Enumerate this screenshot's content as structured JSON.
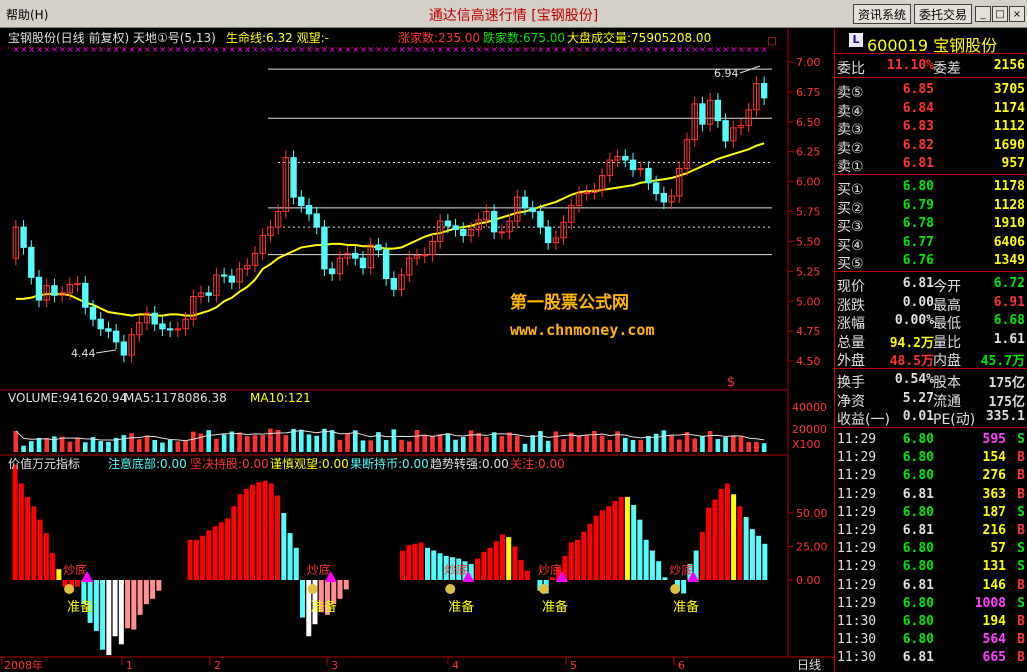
{
  "menu": {
    "help": "帮助(H)"
  },
  "app": {
    "title": "通达信高速行情 [宝钢股份]"
  },
  "toolbar": {
    "news_label": "资讯系统",
    "trade_label": "委托交易"
  },
  "window": {
    "min": "_",
    "max": "□",
    "close": "×"
  },
  "colors": {
    "up": "#ff3232",
    "down": "#54fcfc",
    "ma": "#ffff00",
    "ma_alt": "#00c800",
    "white_bar": "#ffffff",
    "pink_bar": "#ff9090",
    "yellow_bar": "#ffff00",
    "magenta": "#ff00ff",
    "grid": "#b40000",
    "price_label": "#ff3232"
  },
  "chart_data": [
    {
      "type": "candlestick",
      "name": "main",
      "header": {
        "title": "宝钢股份(日线 前复权) 天地①号(5,13)",
        "indicator": "生命线:6.32 观望:-",
        "up_count": "涨家数:235.00",
        "down_count": "跌家数:675.00",
        "market_vol": "大盘成交量:75905208.00"
      },
      "ylim": [
        4.3,
        7.1
      ],
      "yticks": [
        "7.00",
        "6.75",
        "6.50",
        "6.25",
        "6.00",
        "5.75",
        "5.50",
        "5.25",
        "5.00",
        "4.75",
        "4.50"
      ],
      "ytick_values": [
        7.0,
        6.75,
        6.5,
        6.25,
        6.0,
        5.75,
        5.5,
        5.25,
        5.0,
        4.75,
        4.5
      ],
      "annotations": {
        "high": "6.94",
        "low": "4.44",
        "watermark_line1": "第一股票公式网",
        "watermark_line2": "www.chnmoney.com",
        "dollar": "$"
      },
      "candles": [
        [
          5.36,
          5.62
        ],
        [
          5.62,
          5.45
        ],
        [
          5.45,
          5.2
        ],
        [
          5.2,
          5.01
        ],
        [
          5.01,
          5.13
        ],
        [
          5.13,
          5.05
        ],
        [
          5.05,
          5.07
        ],
        [
          5.07,
          5.14
        ],
        [
          5.14,
          5.15
        ],
        [
          5.15,
          4.95
        ],
        [
          4.95,
          4.85
        ],
        [
          4.85,
          4.77
        ],
        [
          4.77,
          4.75
        ],
        [
          4.75,
          4.66
        ],
        [
          4.66,
          4.55
        ],
        [
          4.55,
          4.72
        ],
        [
          4.72,
          4.82
        ],
        [
          4.82,
          4.9
        ],
        [
          4.9,
          4.81
        ],
        [
          4.81,
          4.77
        ],
        [
          4.77,
          4.76
        ],
        [
          4.76,
          4.77
        ],
        [
          4.77,
          4.85
        ],
        [
          4.85,
          5.04
        ],
        [
          5.04,
          5.07
        ],
        [
          5.07,
          5.05
        ],
        [
          5.05,
          5.22
        ],
        [
          5.22,
          5.21
        ],
        [
          5.21,
          5.16
        ],
        [
          5.16,
          5.27
        ],
        [
          5.27,
          5.3
        ],
        [
          5.3,
          5.4
        ],
        [
          5.4,
          5.55
        ],
        [
          5.55,
          5.62
        ],
        [
          5.62,
          5.75
        ],
        [
          5.75,
          6.2
        ],
        [
          6.2,
          5.87
        ],
        [
          5.87,
          5.8
        ],
        [
          5.8,
          5.73
        ],
        [
          5.73,
          5.62
        ],
        [
          5.62,
          5.27
        ],
        [
          5.27,
          5.23
        ],
        [
          5.23,
          5.36
        ],
        [
          5.36,
          5.4
        ],
        [
          5.4,
          5.36
        ],
        [
          5.36,
          5.28
        ],
        [
          5.28,
          5.47
        ],
        [
          5.47,
          5.43
        ],
        [
          5.43,
          5.19
        ],
        [
          5.19,
          5.1
        ],
        [
          5.1,
          5.22
        ],
        [
          5.22,
          5.36
        ],
        [
          5.36,
          5.38
        ],
        [
          5.38,
          5.39
        ],
        [
          5.39,
          5.5
        ],
        [
          5.5,
          5.67
        ],
        [
          5.67,
          5.63
        ],
        [
          5.63,
          5.6
        ],
        [
          5.6,
          5.55
        ],
        [
          5.55,
          5.6
        ],
        [
          5.6,
          5.68
        ],
        [
          5.68,
          5.75
        ],
        [
          5.75,
          5.58
        ],
        [
          5.58,
          5.58
        ],
        [
          5.58,
          5.67
        ],
        [
          5.67,
          5.87
        ],
        [
          5.87,
          5.78
        ],
        [
          5.78,
          5.75
        ],
        [
          5.75,
          5.62
        ],
        [
          5.62,
          5.49
        ],
        [
          5.49,
          5.53
        ],
        [
          5.53,
          5.66
        ],
        [
          5.66,
          5.8
        ],
        [
          5.8,
          5.9
        ],
        [
          5.9,
          5.91
        ],
        [
          5.91,
          5.93
        ],
        [
          5.93,
          6.05
        ],
        [
          6.05,
          6.18
        ],
        [
          6.18,
          6.21
        ],
        [
          6.21,
          6.18
        ],
        [
          6.18,
          6.1
        ],
        [
          6.1,
          6.11
        ],
        [
          6.11,
          5.99
        ],
        [
          5.99,
          5.9
        ],
        [
          5.9,
          5.83
        ],
        [
          5.83,
          5.88
        ],
        [
          5.88,
          6.11
        ],
        [
          6.11,
          6.35
        ],
        [
          6.35,
          6.65
        ],
        [
          6.65,
          6.48
        ],
        [
          6.48,
          6.68
        ],
        [
          6.68,
          6.51
        ],
        [
          6.51,
          6.34
        ],
        [
          6.34,
          6.45
        ],
        [
          6.45,
          6.47
        ],
        [
          6.47,
          6.6
        ],
        [
          6.6,
          6.82
        ],
        [
          6.82,
          6.7
        ]
      ],
      "ma": [
        5.02,
        5.02,
        5.03,
        5.05,
        5.06,
        5.06,
        5.06,
        5.05,
        5.02,
        4.99,
        4.97,
        4.94,
        4.91,
        4.9,
        4.89,
        4.88,
        4.89,
        4.89,
        4.88,
        4.88,
        4.89,
        4.89,
        4.88,
        4.88,
        4.9,
        4.92,
        4.95,
        5.0,
        5.03,
        5.08,
        5.12,
        5.18,
        5.27,
        5.31,
        5.36,
        5.39,
        5.42,
        5.45,
        5.46,
        5.47,
        5.47,
        5.48,
        5.48,
        5.47,
        5.47,
        5.46,
        5.46,
        5.45,
        5.44,
        5.44,
        5.45,
        5.48,
        5.51,
        5.54,
        5.56,
        5.57,
        5.59,
        5.61,
        5.62,
        5.63,
        5.65,
        5.66,
        5.68,
        5.7,
        5.72,
        5.74,
        5.75,
        5.77,
        5.79,
        5.81,
        5.83,
        5.86,
        5.89,
        5.91,
        5.92,
        5.92,
        5.93,
        5.94,
        5.95,
        5.96,
        5.97,
        5.99,
        6.0,
        6.01,
        6.02,
        6.03,
        6.05,
        6.07,
        6.1,
        6.13,
        6.16,
        6.19,
        6.21,
        6.23,
        6.25,
        6.27,
        6.3,
        6.32
      ],
      "hlines_solid": [
        6.94,
        6.53,
        5.78,
        5.39
      ],
      "hlines_dashed": [
        6.16,
        5.62
      ]
    },
    {
      "type": "bar",
      "name": "volume",
      "header": {
        "vol": "VOLUME:941620.94",
        "ma5": "MA5:1178086.38",
        "ma10": "MA10:121"
      },
      "yticks": [
        "40000",
        "20000",
        "X100"
      ],
      "ytick_values": [
        40000,
        20000,
        0
      ],
      "values": [
        1.38,
        0.42,
        0.71,
        0.93,
        0.91,
        1.03,
        1.01,
        0.68,
        0.95,
        0.64,
        0.98,
        0.72,
        0.67,
        0.93,
        1.11,
        1.24,
        0.84,
        1.09,
        0.79,
        0.62,
        0.79,
        0.7,
        0.8,
        1.34,
        1.22,
        1.44,
        0.87,
        1.16,
        1.35,
        1.29,
        1.05,
        1.11,
        1.11,
        1.54,
        1.45,
        1.11,
        1.52,
        1.47,
        1.16,
        1.07,
        1.53,
        1.44,
        0.8,
        1.23,
        1.43,
        0.76,
        0.77,
        1.31,
        0.79,
        1.49,
        0.8,
        0.7,
        1.45,
        1.12,
        1.07,
        1.18,
        1.23,
        0.81,
        0.99,
        1.42,
        1.25,
        0.99,
        1.3,
        1.05,
        1.29,
        1.07,
        0.54,
        1.11,
        1.38,
        0.73,
        1.35,
        0.85,
        1.28,
        1.06,
        1.11,
        1.38,
        1.08,
        0.79,
        1.37,
        0.93,
        0.79,
        0.79,
        1.05,
        1.2,
        1.43,
        1.11,
        0.82,
        1.32,
        0.89,
        1.02,
        1.38,
        0.85,
        0.98,
        1.07,
        1.01,
        0.66,
        0.66,
        0.58
      ],
      "ylim": [
        0,
        2.9
      ]
    },
    {
      "type": "bar",
      "name": "value_indicator",
      "header": {
        "title": "价值万元指标",
        "c1": "注意底部:0.00",
        "c2": "坚决持股:0.00",
        "c3": "谨慎观望:0.00",
        "c4": "果断持币:0.00",
        "c5": "趋势转强:0.00",
        "c6": "关注:0.00"
      },
      "ylim": [
        -20,
        90
      ],
      "yticks": [
        "50.00",
        "25.00",
        "0.00"
      ],
      "ytick_values": [
        50,
        25,
        0
      ],
      "values": [
        86,
        72,
        62,
        55,
        45,
        35,
        20,
        8,
        -5,
        -9,
        -5,
        -18,
        -32,
        -38,
        -52,
        -56,
        -42,
        -48,
        -36,
        -37,
        -26,
        -18,
        -14,
        -8,
        0,
        5,
        8,
        8,
        30,
        30,
        33,
        37,
        40,
        43,
        46,
        55,
        64,
        68,
        71,
        73,
        74,
        72,
        63,
        50,
        35,
        24,
        -28,
        -42,
        -33,
        -24,
        -26,
        -18,
        -14,
        -7,
        0,
        0,
        0,
        0,
        0,
        0,
        0,
        0,
        22,
        26,
        27,
        28,
        24,
        22,
        20,
        18,
        17,
        16,
        14,
        12,
        16,
        21,
        24,
        29,
        34,
        32,
        25,
        15,
        7,
        0,
        -8,
        -10,
        2,
        10,
        18,
        28,
        30,
        36,
        42,
        48,
        52,
        55,
        59,
        62,
        62,
        56,
        45,
        30,
        22,
        14,
        2,
        0,
        -8,
        -10,
        12,
        22,
        36,
        54,
        60,
        68,
        72,
        64,
        55,
        47,
        38,
        33,
        27
      ],
      "kinds": [
        "r",
        "r",
        "r",
        "r",
        "r",
        "r",
        "r",
        "y",
        "r",
        "r",
        "r",
        "c",
        "c",
        "c",
        "c",
        "w",
        "w",
        "w",
        "p",
        "p",
        "p",
        "p",
        "p",
        "p",
        "g",
        "g",
        "g",
        "g",
        "r",
        "r",
        "r",
        "r",
        "r",
        "r",
        "r",
        "r",
        "r",
        "r",
        "r",
        "r",
        "r",
        "r",
        "r",
        "c",
        "c",
        "c",
        "c",
        "w",
        "w",
        "p",
        "p",
        "p",
        "p",
        "p",
        "g",
        "g",
        "g",
        "g",
        "g",
        "g",
        "g",
        "g",
        "r",
        "r",
        "r",
        "r",
        "c",
        "c",
        "c",
        "c",
        "c",
        "c",
        "c",
        "c",
        "r",
        "r",
        "r",
        "r",
        "r",
        "y",
        "r",
        "r",
        "r",
        "r",
        "c",
        "c",
        "r",
        "r",
        "r",
        "r",
        "r",
        "r",
        "r",
        "r",
        "r",
        "r",
        "r",
        "r",
        "y",
        "c",
        "c",
        "c",
        "c",
        "c",
        "c",
        "c",
        "c",
        "c",
        "c",
        "c",
        "r",
        "r",
        "r",
        "r",
        "r",
        "y",
        "r",
        "c",
        "c",
        "c",
        "c",
        "c",
        "r"
      ],
      "signals": [
        {
          "idx": 8,
          "top": "炒底",
          "bottom": "准备"
        },
        {
          "idx": 47,
          "top": "炒底",
          "bottom": "准备"
        },
        {
          "idx": 69,
          "top": "炒底",
          "bottom": "准备"
        },
        {
          "idx": 84,
          "top": "炒底",
          "bottom": "准备"
        },
        {
          "idx": 105,
          "top": "炒底",
          "bottom": "准备"
        }
      ]
    }
  ],
  "xaxis": {
    "labels": [
      "2008年",
      "1",
      "2",
      "3",
      "4",
      "5",
      "6"
    ],
    "period": "日线"
  },
  "quote": {
    "code_name": "600019 宝钢股份",
    "logo": "L",
    "ratio": {
      "l": "委比",
      "v": "11.10%",
      "m": "委差",
      "v2": "2156"
    },
    "asks": [
      {
        "l": "卖⑤",
        "p": "6.85",
        "v": "3705"
      },
      {
        "l": "卖④",
        "p": "6.84",
        "v": "1174"
      },
      {
        "l": "卖③",
        "p": "6.83",
        "v": "1112"
      },
      {
        "l": "卖②",
        "p": "6.82",
        "v": "1690"
      },
      {
        "l": "卖①",
        "p": "6.81",
        "v": "957"
      }
    ],
    "bids": [
      {
        "l": "买①",
        "p": "6.80",
        "v": "1178"
      },
      {
        "l": "买②",
        "p": "6.79",
        "v": "1128"
      },
      {
        "l": "买③",
        "p": "6.78",
        "v": "1910"
      },
      {
        "l": "买④",
        "p": "6.77",
        "v": "6406"
      },
      {
        "l": "买⑤",
        "p": "6.76",
        "v": "1349"
      }
    ],
    "stats": [
      {
        "l": "现价",
        "v": "6.81",
        "vc": "cw",
        "m": "今开",
        "v2": "6.72",
        "v2c": "cg"
      },
      {
        "l": "涨跌",
        "v": "0.00",
        "vc": "cw",
        "m": "最高",
        "v2": "6.91",
        "v2c": "cr"
      },
      {
        "l": "涨幅",
        "v": "0.00%",
        "vc": "cw",
        "m": "最低",
        "v2": "6.68",
        "v2c": "cg"
      },
      {
        "l": "总量",
        "v": "94.2万",
        "vc": "cy",
        "m": "量比",
        "v2": "1.61",
        "v2c": "cw"
      },
      {
        "l": "外盘",
        "v": "48.5万",
        "vc": "cr",
        "m": "内盘",
        "v2": "45.7万",
        "v2c": "cg"
      }
    ],
    "stats2": [
      {
        "l": "换手",
        "v": "0.54%",
        "vc": "cw",
        "m": "股本",
        "v2": "175亿",
        "v2c": "cw"
      },
      {
        "l": "净资",
        "v": "5.27",
        "vc": "cw",
        "m": "流通",
        "v2": "175亿",
        "v2c": "cw"
      },
      {
        "l": "收益(一)",
        "v": "0.01",
        "vc": "cw",
        "m": "PE(动)",
        "v2": "335.1",
        "v2c": "cw"
      }
    ],
    "ticks": [
      {
        "t": "11:29",
        "p": "6.80",
        "pc": "cg",
        "v": "595",
        "vc": "cm",
        "s": "S",
        "sc": "cg"
      },
      {
        "t": "11:29",
        "p": "6.80",
        "pc": "cg",
        "v": "154",
        "vc": "cy",
        "s": "B",
        "sc": "cr"
      },
      {
        "t": "11:29",
        "p": "6.80",
        "pc": "cg",
        "v": "276",
        "vc": "cy",
        "s": "B",
        "sc": "cr"
      },
      {
        "t": "11:29",
        "p": "6.81",
        "pc": "cw",
        "v": "363",
        "vc": "cy",
        "s": "B",
        "sc": "cr"
      },
      {
        "t": "11:29",
        "p": "6.80",
        "pc": "cg",
        "v": "187",
        "vc": "cy",
        "s": "S",
        "sc": "cg"
      },
      {
        "t": "11:29",
        "p": "6.81",
        "pc": "cw",
        "v": "216",
        "vc": "cy",
        "s": "B",
        "sc": "cr"
      },
      {
        "t": "11:29",
        "p": "6.80",
        "pc": "cg",
        "v": "57",
        "vc": "cy",
        "s": "S",
        "sc": "cg"
      },
      {
        "t": "11:29",
        "p": "6.80",
        "pc": "cg",
        "v": "131",
        "vc": "cy",
        "s": "S",
        "sc": "cg"
      },
      {
        "t": "11:29",
        "p": "6.81",
        "pc": "cw",
        "v": "146",
        "vc": "cy",
        "s": "B",
        "sc": "cr"
      },
      {
        "t": "11:29",
        "p": "6.80",
        "pc": "cg",
        "v": "1008",
        "vc": "cm",
        "s": "S",
        "sc": "cg"
      },
      {
        "t": "11:30",
        "p": "6.80",
        "pc": "cg",
        "v": "194",
        "vc": "cy",
        "s": "B",
        "sc": "cr"
      },
      {
        "t": "11:30",
        "p": "6.80",
        "pc": "cg",
        "v": "564",
        "vc": "cm",
        "s": "B",
        "sc": "cr"
      },
      {
        "t": "11:30",
        "p": "6.81",
        "pc": "cw",
        "v": "665",
        "vc": "cm",
        "s": "B",
        "sc": "cr"
      }
    ]
  }
}
